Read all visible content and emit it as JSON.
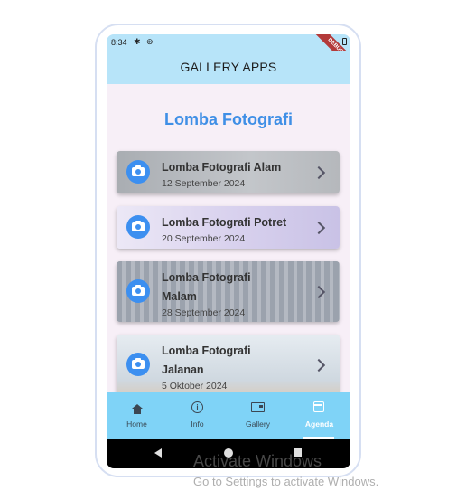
{
  "statusbar": {
    "time": "8:34",
    "debug_label": "DEBUG"
  },
  "appbar": {
    "title": "GALLERY APPS"
  },
  "main": {
    "heading": "Lomba Fotografi",
    "cards": [
      {
        "name": "Lomba Fotografi Alam",
        "date": "12 September 2024",
        "icon": "camera-icon"
      },
      {
        "name": "Lomba Fotografi Potret",
        "date": "20 September 2024",
        "icon": "camera-icon"
      },
      {
        "name_line1": "Lomba Fotografi",
        "name_line2": "Malam",
        "date": "28 September 2024",
        "icon": "camera-icon"
      },
      {
        "name_line1": "Lomba Fotografi",
        "name_line2": "Jalanan",
        "date": "5 Oktober 2024",
        "icon": "camera-icon"
      }
    ]
  },
  "bottom_nav": {
    "items": [
      {
        "label": "Home",
        "icon": "home-icon"
      },
      {
        "label": "Info",
        "icon": "info-icon"
      },
      {
        "label": "Gallery",
        "icon": "gallery-icon"
      },
      {
        "label": "Agenda",
        "icon": "calendar-icon",
        "active": true
      }
    ]
  },
  "watermark": {
    "line1": "Activate Windows",
    "line2": "Go to Settings to activate Windows."
  },
  "colors": {
    "appbar": "#b7e4f9",
    "accent": "#3f8fe6",
    "nav": "#7fd3f7"
  }
}
